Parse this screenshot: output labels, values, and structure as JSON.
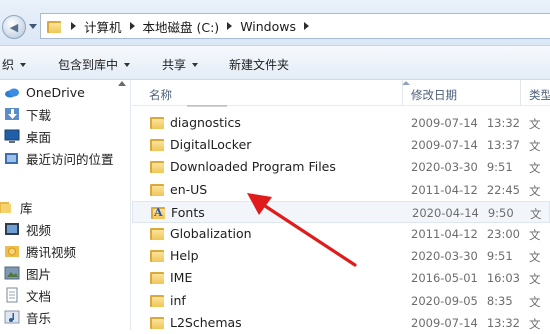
{
  "address": {
    "crumbs": [
      "计算机",
      "本地磁盘 (C:)",
      "Windows"
    ]
  },
  "toolbar": {
    "organize_label": "织",
    "include_label": "包含到库中",
    "share_label": "共享",
    "new_folder_label": "新建文件夹"
  },
  "nav": {
    "items": [
      {
        "label": "OneDrive",
        "icon": "cloud-icon"
      },
      {
        "label": "下载",
        "icon": "download-folder-icon"
      },
      {
        "label": "桌面",
        "icon": "desktop-icon"
      },
      {
        "label": "最近访问的位置",
        "icon": "recent-places-icon"
      },
      {
        "label": "库",
        "icon": "library-icon"
      },
      {
        "label": "视频",
        "icon": "video-library-icon"
      },
      {
        "label": "腾讯视频",
        "icon": "tencent-video-folder-icon"
      },
      {
        "label": "图片",
        "icon": "pictures-library-icon"
      },
      {
        "label": "文档",
        "icon": "documents-library-icon"
      },
      {
        "label": "音乐",
        "icon": "music-library-icon"
      }
    ]
  },
  "columns": {
    "name": "名称",
    "date": "修改日期",
    "type": "类型"
  },
  "files": [
    {
      "name": "diagnostics",
      "date": "2009-07-14",
      "time": "13:32",
      "type": "文",
      "icon": "folder-icon"
    },
    {
      "name": "DigitalLocker",
      "date": "2009-07-14",
      "time": "13:37",
      "type": "文",
      "icon": "folder-icon"
    },
    {
      "name": "Downloaded Program Files",
      "date": "2020-03-30",
      "time": "9:51",
      "type": "文",
      "icon": "folder-icon"
    },
    {
      "name": "en-US",
      "date": "2011-04-12",
      "time": "22:45",
      "type": "文",
      "icon": "folder-icon"
    },
    {
      "name": "Fonts",
      "date": "2020-04-14",
      "time": "9:50",
      "type": "文",
      "icon": "fonts-folder-icon"
    },
    {
      "name": "Globalization",
      "date": "2011-04-12",
      "time": "23:00",
      "type": "文",
      "icon": "folder-icon"
    },
    {
      "name": "Help",
      "date": "2020-03-30",
      "time": "9:51",
      "type": "文",
      "icon": "folder-icon"
    },
    {
      "name": "IME",
      "date": "2016-05-01",
      "time": "16:03",
      "type": "文",
      "icon": "folder-icon"
    },
    {
      "name": "inf",
      "date": "2020-09-05",
      "time": "8:35",
      "type": "文",
      "icon": "folder-icon"
    },
    {
      "name": "L2Schemas",
      "date": "2009-07-14",
      "time": "13:32",
      "type": "文",
      "icon": "folder-icon"
    }
  ],
  "annotation": {
    "color": "#e01b1b",
    "icon": "red-arrow-pointer"
  }
}
